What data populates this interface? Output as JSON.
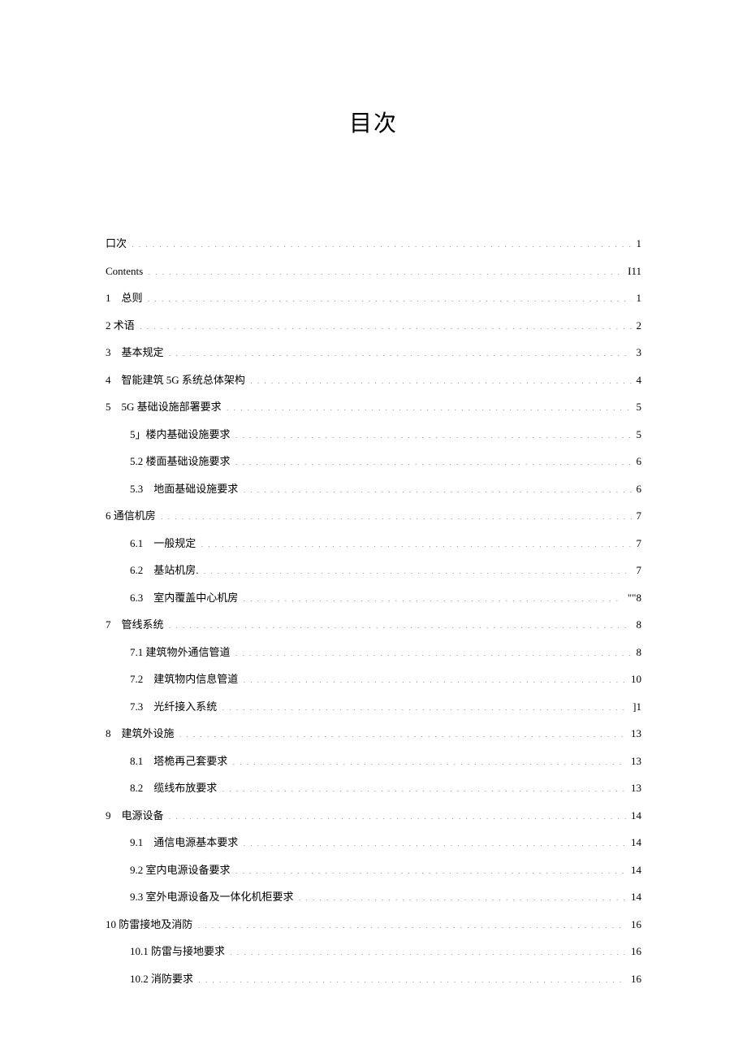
{
  "title": "目次",
  "entries": [
    {
      "level": 1,
      "label": "口次",
      "page": "1"
    },
    {
      "level": 1,
      "label": "Contents",
      "page": "I11"
    },
    {
      "level": 1,
      "label": "1　总则",
      "page": "1"
    },
    {
      "level": 1,
      "label": "2 术语",
      "page": "2"
    },
    {
      "level": 1,
      "label": "3　基本规定",
      "page": "3"
    },
    {
      "level": 1,
      "label": "4　智能建筑 5G 系统总体架构",
      "page": "4"
    },
    {
      "level": 1,
      "label": "5　5G 基础设施部署要求",
      "page": "5"
    },
    {
      "level": 2,
      "label": "5」楼内基础设施要求",
      "page": "5"
    },
    {
      "level": 2,
      "label": "5.2 楼面基础设施要求",
      "page": "6"
    },
    {
      "level": 2,
      "label": "5.3　地面基础设施要求",
      "page": "6"
    },
    {
      "level": 1,
      "label": "6 通信机房",
      "page": "7"
    },
    {
      "level": 2,
      "label": "6.1　一般规定",
      "page": "7"
    },
    {
      "level": 2,
      "label": "6.2　基站机房.",
      "page": "7"
    },
    {
      "level": 2,
      "label": "6.3　室内覆盖中心机房",
      "page": "\"\"8"
    },
    {
      "level": 1,
      "label": "7　管线系统",
      "page": "8"
    },
    {
      "level": 2,
      "label": "7.1 建筑物外通信管道",
      "page": "8"
    },
    {
      "level": 2,
      "label": "7.2　建筑物内信息管道",
      "page": "10"
    },
    {
      "level": 2,
      "label": "7.3　光纤接入系统",
      "page": "]1"
    },
    {
      "level": 1,
      "label": "8　建筑外设施",
      "page": "13"
    },
    {
      "level": 2,
      "label": "8.1　塔桅再己套要求",
      "page": "13"
    },
    {
      "level": 2,
      "label": "8.2　缆线布放要求",
      "page": "13"
    },
    {
      "level": 1,
      "label": "9　电源设备",
      "page": "14"
    },
    {
      "level": 2,
      "label": "9.1　通信电源基本要求",
      "page": "14"
    },
    {
      "level": 2,
      "label": "9.2 室内电源设备要求",
      "page": "14"
    },
    {
      "level": 2,
      "label": "9.3 室外电源设备及一体化机柜要求",
      "page": "14"
    },
    {
      "level": 1,
      "label": "10 防雷接地及消防",
      "page": "16"
    },
    {
      "level": 2,
      "label": "10.1 防雷与接地要求",
      "page": "16"
    },
    {
      "level": 2,
      "label": "10.2 消防要求",
      "page": "16"
    }
  ]
}
